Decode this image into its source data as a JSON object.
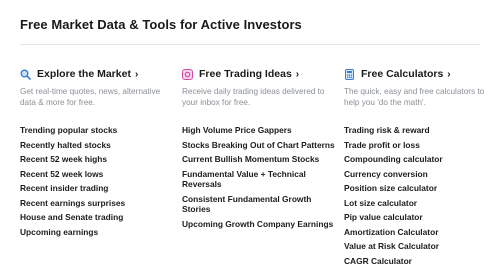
{
  "page_title": "Free Market Data & Tools for Active Investors",
  "columns": [
    {
      "title": "Explore the Market",
      "icon": "magnifier-icon",
      "chevron": "›",
      "description": "Get real-time quotes, news, alternative data & more for free.",
      "links": [
        "Trending popular stocks",
        "Recently halted stocks",
        "Recent 52 week highs",
        "Recent 52 week lows",
        "Recent insider trading",
        "Recent earnings surprises",
        "House and Senate trading",
        "Upcoming earnings"
      ]
    },
    {
      "title": "Free Trading Ideas",
      "icon": "ideas-icon",
      "chevron": "›",
      "description": "Receive daily trading ideas delivered to your inbox for free.",
      "links": [
        "High Volume Price Gappers",
        "Stocks Breaking Out of Chart Patterns",
        "Current Bullish Momentum Stocks",
        "Fundamental Value + Technical Reversals",
        "Consistent Fundamental Growth Stories",
        "Upcoming Growth Company Earnings"
      ]
    },
    {
      "title": "Free Calculators",
      "icon": "calculator-icon",
      "chevron": "›",
      "description": "The quick, easy and free calculators to help you 'do the math'.",
      "links": [
        "Trading risk & reward",
        "Trade profit or loss",
        "Compounding calculator",
        "Currency conversion",
        "Position size calculator",
        "Lot size calculator",
        "Pip value calculator",
        "Amortization Calculator",
        "Value at Risk Calculator",
        "CAGR Calculator"
      ]
    }
  ]
}
